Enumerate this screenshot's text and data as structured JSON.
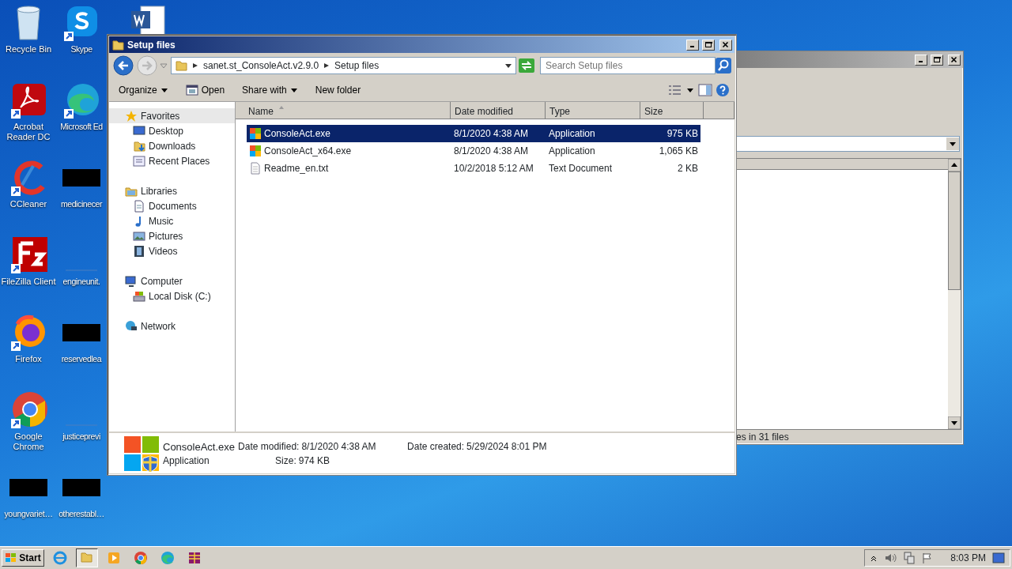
{
  "desktop_icons": [
    {
      "label": "Recycle Bin"
    },
    {
      "label": "Skype"
    },
    {
      "label": "Acrobat Reader DC"
    },
    {
      "label": "Microsoft Ed"
    },
    {
      "label": "CCleaner"
    },
    {
      "label": "medicinecer"
    },
    {
      "label": "FileZilla Client"
    },
    {
      "label": "engineunit."
    },
    {
      "label": "Firefox"
    },
    {
      "label": "reservedlea"
    },
    {
      "label": "Google Chrome"
    },
    {
      "label": "justiceprevi"
    },
    {
      "label": "youngvariet…"
    },
    {
      "label": "otherestabl…"
    }
  ],
  "background_window": {
    "status": "es in 31 files"
  },
  "explorer": {
    "title": "Setup files",
    "breadcrumb": [
      "sanet.st_ConsoleAct.v2.9.0",
      "Setup files"
    ],
    "search": {
      "placeholder": "Search Setup files"
    },
    "toolbar": [
      {
        "label": "Organize",
        "dropdown": true
      },
      {
        "label": "Open",
        "dropdown": false
      },
      {
        "label": "Share with",
        "dropdown": true
      },
      {
        "label": "New folder",
        "dropdown": false
      }
    ],
    "nav": [
      {
        "label": "Favorites",
        "selected": true,
        "children": [
          {
            "label": "Desktop",
            "selected": false
          },
          {
            "label": "Downloads",
            "selected": false
          },
          {
            "label": "Recent Places",
            "selected": false
          }
        ]
      },
      {
        "label": "Libraries",
        "selected": false,
        "children": [
          {
            "label": "Documents",
            "selected": false
          },
          {
            "label": "Music",
            "selected": false
          },
          {
            "label": "Pictures",
            "selected": false
          },
          {
            "label": "Videos",
            "selected": false
          }
        ]
      },
      {
        "label": "Computer",
        "selected": false,
        "children": [
          {
            "label": "Local Disk (C:)",
            "selected": false
          }
        ]
      },
      {
        "label": "Network",
        "selected": false
      }
    ],
    "columns": [
      {
        "label": "Name",
        "sorted": true
      },
      {
        "label": "Date modified",
        "sorted": false
      },
      {
        "label": "Type",
        "sorted": false
      },
      {
        "label": "Size",
        "sorted": false
      }
    ],
    "files": [
      {
        "name": "ConsoleAct.exe",
        "date": "8/1/2020 4:38 AM",
        "type": "Application",
        "size": "975 KB",
        "kind": "exe",
        "selected": true
      },
      {
        "name": "ConsoleAct_x64.exe",
        "date": "8/1/2020 4:38 AM",
        "type": "Application",
        "size": "1,065 KB",
        "kind": "exe",
        "selected": false
      },
      {
        "name": "Readme_en.txt",
        "date": "10/2/2018 5:12 AM",
        "type": "Text Document",
        "size": "2 KB",
        "kind": "txt",
        "selected": false
      }
    ],
    "details": {
      "name": "ConsoleAct.exe",
      "type": "Application",
      "fields": [
        {
          "label": "Date modified:",
          "value": "8/1/2020 4:38 AM"
        },
        {
          "label": "Size:",
          "value": "974 KB"
        },
        {
          "label": "Date created:",
          "value": "5/29/2024 8:01 PM"
        }
      ]
    }
  },
  "taskbar": {
    "start": "Start",
    "items": [
      {
        "selected": false
      },
      {
        "selected": true
      },
      {
        "selected": false
      },
      {
        "selected": false
      },
      {
        "selected": false
      },
      {
        "selected": false
      }
    ],
    "clock": "8:03 PM"
  }
}
